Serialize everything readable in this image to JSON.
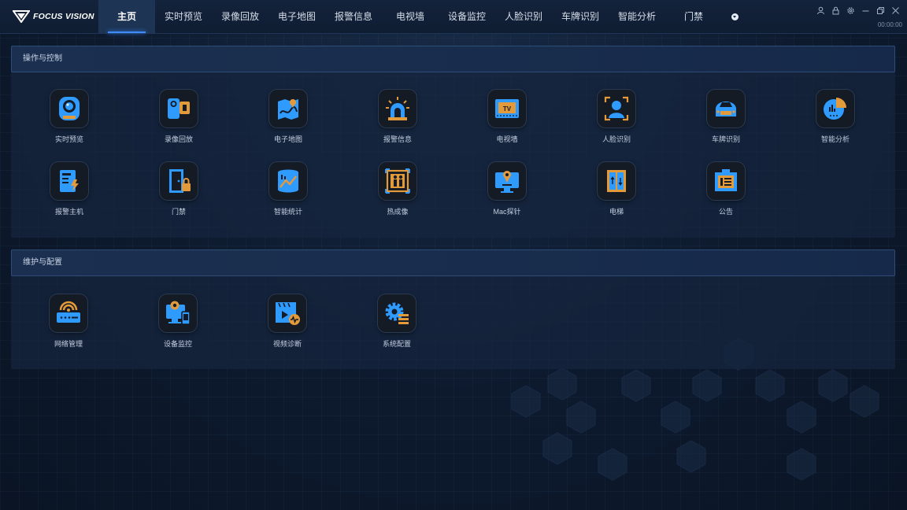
{
  "brand": {
    "name": "FOCUS VISION"
  },
  "nav": [
    {
      "label": "主页",
      "active": true
    },
    {
      "label": "实时预览"
    },
    {
      "label": "录像回放"
    },
    {
      "label": "电子地图"
    },
    {
      "label": "报警信息"
    },
    {
      "label": "电视墙"
    },
    {
      "label": "设备监控"
    },
    {
      "label": "人脸识别"
    },
    {
      "label": "车牌识别"
    },
    {
      "label": "智能分析"
    },
    {
      "label": "门禁"
    }
  ],
  "clock": "00:00:00",
  "window_icons": [
    "user-icon",
    "lock-icon",
    "settings-icon",
    "minimize-icon",
    "restore-icon",
    "close-icon"
  ],
  "colors": {
    "accent": "#2f9bff",
    "icon_orange": "#e39a3b",
    "panel_border": "#2f4c77"
  },
  "sections": [
    {
      "title": "操作与控制",
      "apps": [
        {
          "label": "实时预览",
          "icon": "camera-icon"
        },
        {
          "label": "录像回放",
          "icon": "video-camera-icon"
        },
        {
          "label": "电子地图",
          "icon": "map-icon"
        },
        {
          "label": "报警信息",
          "icon": "alarm-light-icon"
        },
        {
          "label": "电视墙",
          "icon": "tv-wall-icon"
        },
        {
          "label": "人脸识别",
          "icon": "face-recognition-icon"
        },
        {
          "label": "车牌识别",
          "icon": "car-plate-icon"
        },
        {
          "label": "智能分析",
          "icon": "pie-chart-icon"
        },
        {
          "label": "报警主机",
          "icon": "alarm-host-icon"
        },
        {
          "label": "门禁",
          "icon": "door-lock-icon"
        },
        {
          "label": "智能统计",
          "icon": "statistics-icon"
        },
        {
          "label": "热成像",
          "icon": "thermal-icon"
        },
        {
          "label": "Mac探针",
          "icon": "mac-probe-icon"
        },
        {
          "label": "电梯",
          "icon": "elevator-icon"
        },
        {
          "label": "公告",
          "icon": "notice-board-icon"
        }
      ]
    },
    {
      "title": "维护与配置",
      "apps": [
        {
          "label": "网络管理",
          "icon": "network-icon"
        },
        {
          "label": "设备监控",
          "icon": "device-monitor-icon"
        },
        {
          "label": "视频诊断",
          "icon": "video-diagnosis-icon"
        },
        {
          "label": "系统配置",
          "icon": "system-config-icon"
        }
      ]
    }
  ]
}
